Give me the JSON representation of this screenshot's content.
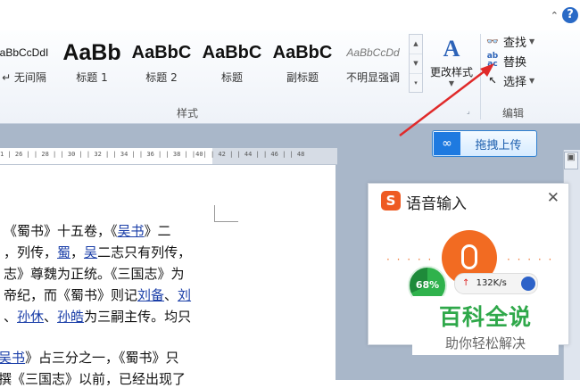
{
  "top": {
    "collapse_glyph": "⌃",
    "help_glyph": "?"
  },
  "ribbon": {
    "styles": [
      {
        "preview": "aBbCcDdI",
        "label": "↵ 无间隔"
      },
      {
        "preview": "AaBb",
        "label": "标题 1"
      },
      {
        "preview": "AaBbC",
        "label": "标题 2"
      },
      {
        "preview": "AaBbC",
        "label": "标题"
      },
      {
        "preview": "AaBbC",
        "label": "副标题"
      },
      {
        "preview": "AaBbCcDd",
        "label": "不明显强调"
      }
    ],
    "change_styles": {
      "icon": "A",
      "label": "更改样式"
    },
    "editing": {
      "find": "查找",
      "replace": "替换",
      "select": "选择"
    },
    "group_styles_label": "样式",
    "group_edit_label": "编辑",
    "launcher_glyph": "⌟"
  },
  "ruler": {
    "ticks": "1  | 26 |  | 28 |  | 30 |  | 32 |  | 34 |  | 36 |  | 38 |  |40|  | 42 |  | 44 |  | 46 |  | 48"
  },
  "document": {
    "lines": [
      [
        {
          "t": "《蜀书》十五卷，《",
          "l": false
        },
        {
          "t": "吴书",
          "l": true
        },
        {
          "t": "》二",
          "l": false
        }
      ],
      [
        {
          "t": "，列传，",
          "l": false
        },
        {
          "t": "蜀",
          "l": true
        },
        {
          "t": "，",
          "l": false
        },
        {
          "t": "吴",
          "l": true
        },
        {
          "t": "二志只有列传，",
          "l": false
        }
      ],
      [
        {
          "t": "志》尊魏为正统。《三国志》为",
          "l": false
        }
      ],
      [
        {
          "t": "帝纪，而《蜀书》则记",
          "l": false
        },
        {
          "t": "刘备",
          "l": true
        },
        {
          "t": "、",
          "l": false
        },
        {
          "t": "刘",
          "l": true
        }
      ],
      [
        {
          "t": "、",
          "l": false
        },
        {
          "t": "孙休",
          "l": true
        },
        {
          "t": "、",
          "l": false
        },
        {
          "t": "孙皓",
          "l": true
        },
        {
          "t": "为三嗣主传。均只",
          "l": false
        }
      ],
      [
        {
          "t": "吴书",
          "l": true
        },
        {
          "t": "》占三分之一，《蜀书》只",
          "l": false
        }
      ],
      [
        {
          "t": "撰《三国志》以前，已经出现了",
          "l": false
        }
      ]
    ]
  },
  "upload": {
    "label": "拖拽上传",
    "icon": "∞"
  },
  "voice": {
    "logo": "S",
    "title": "语音输入",
    "close": "✕",
    "percent": "68%",
    "speed": "132K/s",
    "up_arrow": "↑",
    "dots": "· · · · ·"
  },
  "watermark": {
    "main": "百科全说",
    "sub": "助你轻松解决"
  },
  "colors": {
    "accent": "#2d63b8",
    "arrow": "#e02a2a",
    "voice_orange": "#f26b22",
    "watermark_green": "#2fa84a"
  }
}
